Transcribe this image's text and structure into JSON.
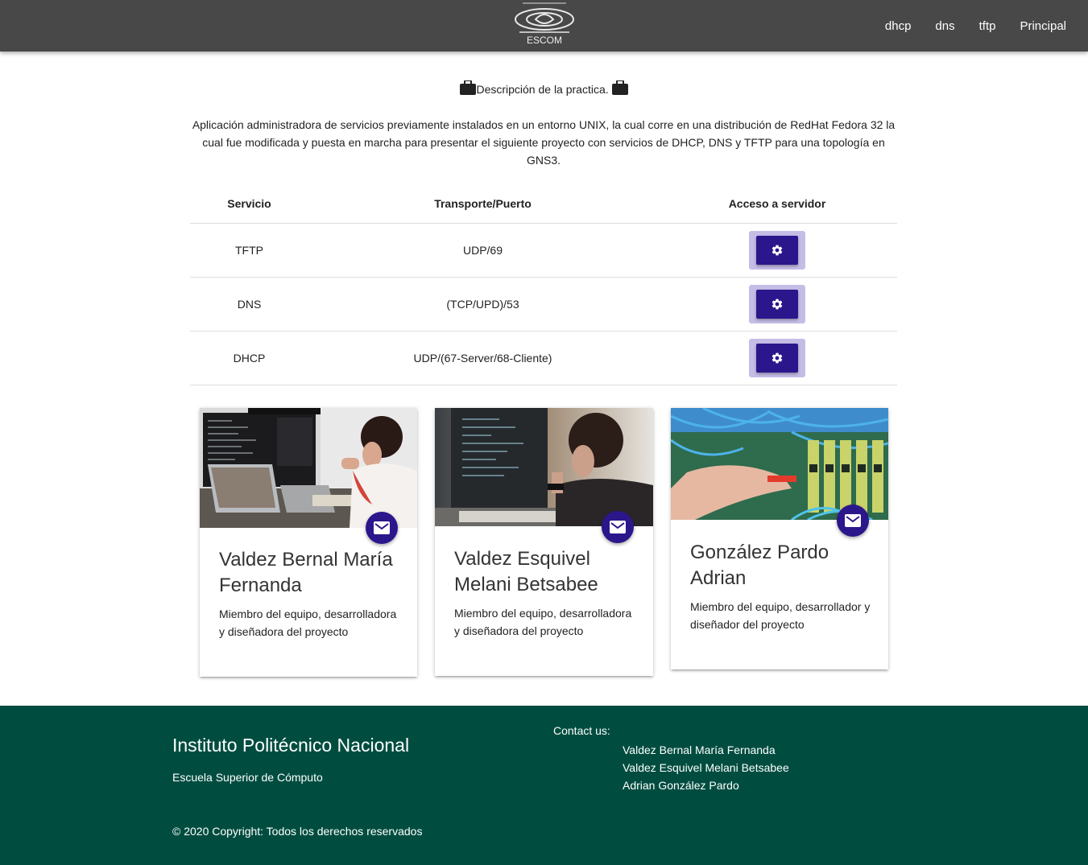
{
  "navbar": {
    "logo_text": "ESCOM",
    "links": [
      "dhcp",
      "dns",
      "tftp",
      "Principal"
    ]
  },
  "intro": {
    "title": "Descripción de la practica.",
    "description": "Aplicación administradora de servicios previamente instalados en un entorno UNIX, la cual corre en una distribución de RedHat Fedora 32 la cual fue modificada y puesta en marcha para presentar el siguiente proyecto con servicios de DHCP, DNS y TFTP para una topología en GNS3."
  },
  "table": {
    "headers": [
      "Servicio",
      "Transporte/Puerto",
      "Acceso a servidor"
    ],
    "rows": [
      {
        "service": "TFTP",
        "port": "UDP/69"
      },
      {
        "service": "DNS",
        "port": "(TCP/UPD)/53"
      },
      {
        "service": "DHCP",
        "port": "UDP/(67-Server/68-Cliente)"
      }
    ]
  },
  "cards": [
    {
      "name": "Valdez Bernal María Fernanda",
      "text": "Miembro del equipo, desarrolladora y diseñadora del proyecto"
    },
    {
      "name": "Valdez Esquivel Melani Betsabee",
      "text": "Miembro del equipo, desarrolladora y diseñadora del proyecto"
    },
    {
      "name": "González Pardo Adrian",
      "text": "Miembro del equipo, desarrollador y diseñador del proyecto"
    }
  ],
  "footer": {
    "title": "Instituto Politécnico Nacional",
    "subtitle": "Escuela Superior de Cómputo",
    "contact_label": "Contact us:",
    "contacts": [
      "Valdez Bernal María Fernanda",
      "Valdez Esquivel Melani Betsabee",
      "Adrian González Pardo"
    ],
    "copyright": "© 2020 Copyright: Todos los derechos reservados"
  },
  "colors": {
    "navbar": "#484848",
    "accent": "#2c168b",
    "footer": "#004d40"
  },
  "icons": [
    "briefcase-icon",
    "gear-icon",
    "mail-icon"
  ]
}
